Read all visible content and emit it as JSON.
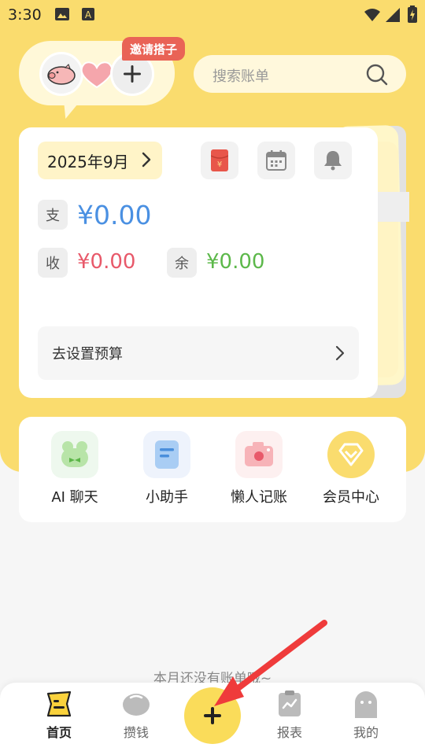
{
  "status_bar": {
    "time": "3:30"
  },
  "header": {
    "invite_label": "邀请搭子",
    "search_placeholder": "搜索账单"
  },
  "ledger_card": {
    "month": "2025年9月",
    "expense_tag": "支",
    "expense_amount": "¥0.00",
    "income_tag": "收",
    "income_amount": "¥0.00",
    "balance_tag": "余",
    "balance_amount": "¥0.00",
    "budget_label": "去设置预算"
  },
  "quick_actions": [
    {
      "label": "AI 聊天",
      "icon": "frog-icon"
    },
    {
      "label": "小助手",
      "icon": "note-icon"
    },
    {
      "label": "懒人记账",
      "icon": "camera-icon"
    },
    {
      "label": "会员中心",
      "icon": "diamond-icon"
    }
  ],
  "empty_message": "本月还没有账单哦~",
  "bottom_nav": {
    "home": "首页",
    "save": "攒钱",
    "report": "报表",
    "me": "我的"
  },
  "colors": {
    "brand_yellow": "#fadc6e",
    "expense_blue": "#4a90e2",
    "income_red": "#e8596a",
    "balance_green": "#5cb84a",
    "arrow_red": "#ef3b3b"
  }
}
